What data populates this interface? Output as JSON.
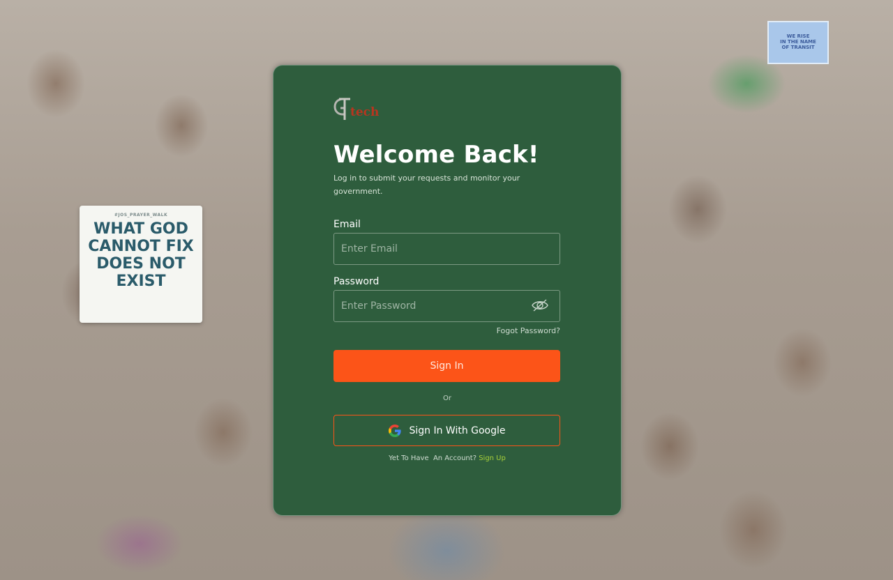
{
  "background": {
    "poster": {
      "tag": "#JOS_PRAYER_WALK",
      "lines": [
        "WHAT GOD",
        "CANNOT FIX",
        "DOES NOT",
        "EXIST"
      ]
    },
    "placard": {
      "lines": [
        "WE RISE",
        "IN THE NAME",
        "OF TRANSIT"
      ]
    }
  },
  "card": {
    "logo_icon": "gtech-logo-icon",
    "title": "Welcome Back!",
    "subtitle": "Log in to submit your requests and monitor your government.",
    "email": {
      "label": "Email",
      "placeholder": "Enter Email",
      "value": ""
    },
    "password": {
      "label": "Password",
      "placeholder": "Enter Password",
      "value": "",
      "toggle_icon": "eye-slash-icon"
    },
    "forgot_label": "Fogot Password?",
    "signin_label": "Sign In",
    "or_label": "Or",
    "google_label": "Sign In With Google",
    "google_icon": "google-icon",
    "no_account_text": "Yet To Have  An Account? ",
    "signup_label": "Sign Up"
  },
  "colors": {
    "card_bg": "#2e5d3d",
    "primary": "#fc5418",
    "link": "#a8d03a"
  }
}
